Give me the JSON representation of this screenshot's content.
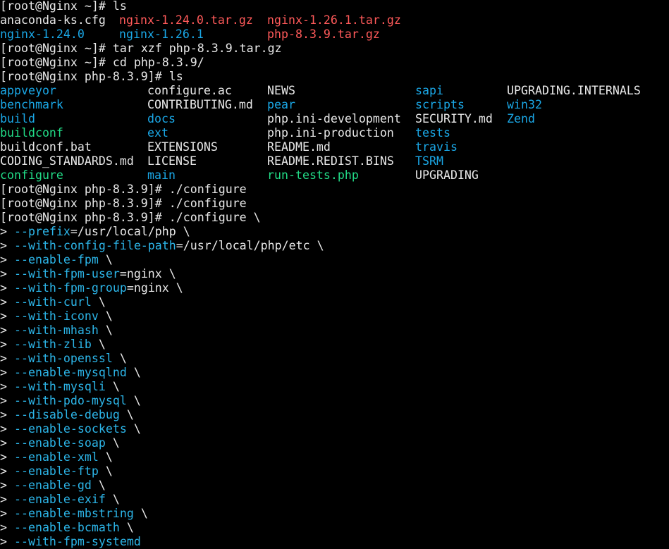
{
  "terminal": {
    "colors": {
      "background": "#000000",
      "text": "#e8e8e8",
      "directory": "#1aa7e6",
      "archive": "#ff5a5a",
      "executable": "#22dd88",
      "option": "#2cb5e8"
    },
    "lines": [
      {
        "kind": "prompt",
        "prompt": "[root@Nginx ~]# ",
        "command": "ls"
      },
      {
        "kind": "ls",
        "cells": [
          {
            "text": "anaconda-ks.cfg",
            "type": "file"
          },
          {
            "text": "nginx-1.24.0.tar.gz",
            "type": "archive"
          },
          {
            "text": "nginx-1.26.1.tar.gz",
            "type": "archive"
          }
        ]
      },
      {
        "kind": "ls",
        "cells": [
          {
            "text": "nginx-1.24.0",
            "type": "dir"
          },
          {
            "text": "nginx-1.26.1",
            "type": "dir"
          },
          {
            "text": "php-8.3.9.tar.gz",
            "type": "archive"
          }
        ]
      },
      {
        "kind": "prompt",
        "prompt": "[root@Nginx ~]# ",
        "command": "tar xzf php-8.3.9.tar.gz"
      },
      {
        "kind": "prompt",
        "prompt": "[root@Nginx ~]# ",
        "command": "cd php-8.3.9/"
      },
      {
        "kind": "prompt",
        "prompt": "[root@Nginx php-8.3.9]# ",
        "command": "ls"
      },
      {
        "kind": "ls",
        "cells": [
          {
            "text": "appveyor",
            "type": "dir"
          },
          {
            "text": "configure.ac",
            "type": "file"
          },
          {
            "text": "NEWS",
            "type": "file"
          },
          {
            "text": "sapi",
            "type": "dir"
          },
          {
            "text": "UPGRADING.INTERNALS",
            "type": "file"
          }
        ]
      },
      {
        "kind": "ls",
        "cells": [
          {
            "text": "benchmark",
            "type": "dir"
          },
          {
            "text": "CONTRIBUTING.md",
            "type": "file"
          },
          {
            "text": "pear",
            "type": "dir"
          },
          {
            "text": "scripts",
            "type": "dir"
          },
          {
            "text": "win32",
            "type": "dir"
          }
        ]
      },
      {
        "kind": "ls",
        "cells": [
          {
            "text": "build",
            "type": "dir"
          },
          {
            "text": "docs",
            "type": "dir"
          },
          {
            "text": "php.ini-development",
            "type": "file"
          },
          {
            "text": "SECURITY.md",
            "type": "file"
          },
          {
            "text": "Zend",
            "type": "dir"
          }
        ]
      },
      {
        "kind": "ls",
        "cells": [
          {
            "text": "buildconf",
            "type": "exec"
          },
          {
            "text": "ext",
            "type": "dir"
          },
          {
            "text": "php.ini-production",
            "type": "file"
          },
          {
            "text": "tests",
            "type": "dir"
          }
        ]
      },
      {
        "kind": "ls",
        "cells": [
          {
            "text": "buildconf.bat",
            "type": "file"
          },
          {
            "text": "EXTENSIONS",
            "type": "file"
          },
          {
            "text": "README.md",
            "type": "file"
          },
          {
            "text": "travis",
            "type": "dir"
          }
        ]
      },
      {
        "kind": "ls",
        "cells": [
          {
            "text": "CODING_STANDARDS.md",
            "type": "file"
          },
          {
            "text": "LICENSE",
            "type": "file"
          },
          {
            "text": "README.REDIST.BINS",
            "type": "file"
          },
          {
            "text": "TSRM",
            "type": "dir"
          }
        ]
      },
      {
        "kind": "ls",
        "cells": [
          {
            "text": "configure",
            "type": "exec"
          },
          {
            "text": "main",
            "type": "dir"
          },
          {
            "text": "run-tests.php",
            "type": "exec"
          },
          {
            "text": "UPGRADING",
            "type": "file"
          }
        ]
      },
      {
        "kind": "prompt",
        "prompt": "[root@Nginx php-8.3.9]# ",
        "command": "./configure"
      },
      {
        "kind": "prompt",
        "prompt": "[root@Nginx php-8.3.9]# ",
        "command": "./configure"
      },
      {
        "kind": "prompt",
        "prompt": "[root@Nginx php-8.3.9]# ",
        "command": "./configure \\"
      },
      {
        "kind": "cont",
        "marker": "> ",
        "option": "--prefix",
        "value": "=/usr/local/php",
        "tail": " \\"
      },
      {
        "kind": "cont",
        "marker": "> ",
        "option": "--with-config-file-path",
        "value": "=/usr/local/php/etc",
        "tail": " \\"
      },
      {
        "kind": "cont",
        "marker": "> ",
        "option": "--enable-fpm",
        "value": "",
        "tail": " \\"
      },
      {
        "kind": "cont",
        "marker": "> ",
        "option": "--with-fpm-user",
        "value": "=nginx",
        "tail": " \\"
      },
      {
        "kind": "cont",
        "marker": "> ",
        "option": "--with-fpm-group",
        "value": "=nginx",
        "tail": " \\"
      },
      {
        "kind": "cont",
        "marker": "> ",
        "option": "--with-curl",
        "value": "",
        "tail": " \\"
      },
      {
        "kind": "cont",
        "marker": "> ",
        "option": "--with-iconv",
        "value": "",
        "tail": " \\"
      },
      {
        "kind": "cont",
        "marker": "> ",
        "option": "--with-mhash",
        "value": "",
        "tail": " \\"
      },
      {
        "kind": "cont",
        "marker": "> ",
        "option": "--with-zlib",
        "value": "",
        "tail": " \\"
      },
      {
        "kind": "cont",
        "marker": "> ",
        "option": "--with-openssl",
        "value": "",
        "tail": " \\"
      },
      {
        "kind": "cont",
        "marker": "> ",
        "option": "--enable-mysqlnd",
        "value": "",
        "tail": " \\"
      },
      {
        "kind": "cont",
        "marker": "> ",
        "option": "--with-mysqli",
        "value": "",
        "tail": " \\"
      },
      {
        "kind": "cont",
        "marker": "> ",
        "option": "--with-pdo-mysql",
        "value": "",
        "tail": " \\"
      },
      {
        "kind": "cont",
        "marker": "> ",
        "option": "--disable-debug",
        "value": "",
        "tail": " \\"
      },
      {
        "kind": "cont",
        "marker": "> ",
        "option": "--enable-sockets",
        "value": "",
        "tail": " \\"
      },
      {
        "kind": "cont",
        "marker": "> ",
        "option": "--enable-soap",
        "value": "",
        "tail": " \\"
      },
      {
        "kind": "cont",
        "marker": "> ",
        "option": "--enable-xml",
        "value": "",
        "tail": " \\"
      },
      {
        "kind": "cont",
        "marker": "> ",
        "option": "--enable-ftp",
        "value": "",
        "tail": " \\"
      },
      {
        "kind": "cont",
        "marker": "> ",
        "option": "--enable-gd",
        "value": "",
        "tail": " \\"
      },
      {
        "kind": "cont",
        "marker": "> ",
        "option": "--enable-exif",
        "value": "",
        "tail": " \\"
      },
      {
        "kind": "cont",
        "marker": "> ",
        "option": "--enable-mbstring",
        "value": "",
        "tail": " \\"
      },
      {
        "kind": "cont",
        "marker": "> ",
        "option": "--enable-bcmath",
        "value": "",
        "tail": " \\"
      },
      {
        "kind": "cont",
        "marker": "> ",
        "option": "--with-fpm-systemd",
        "value": "",
        "tail": ""
      }
    ]
  }
}
